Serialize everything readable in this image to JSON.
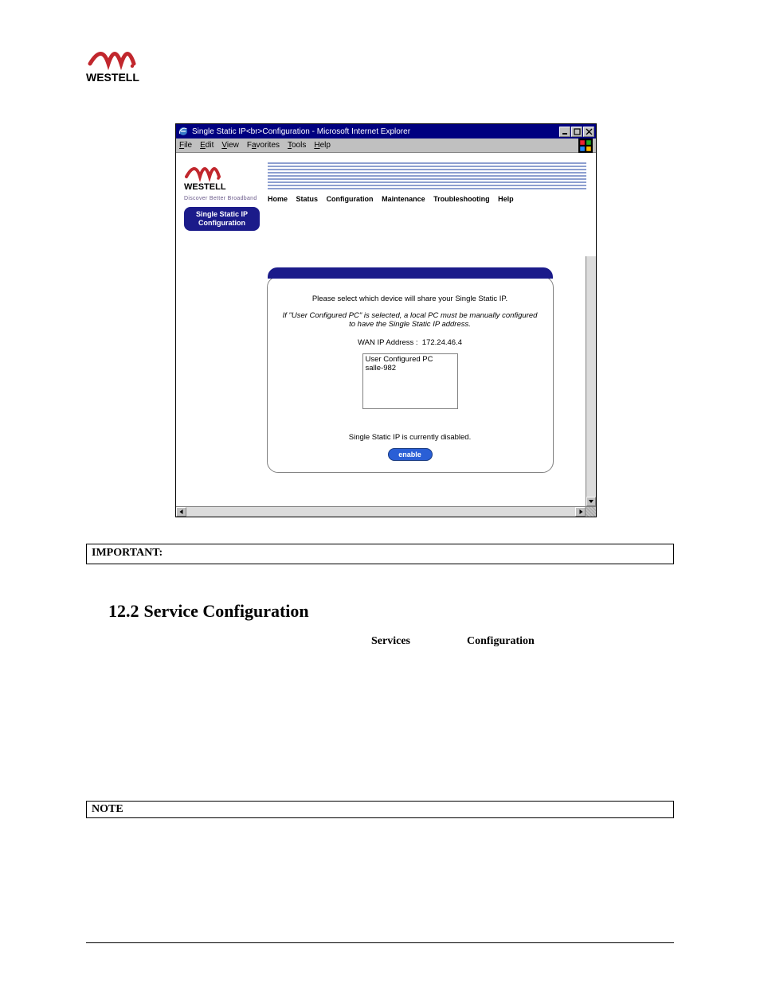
{
  "logo_text": "WESTELL",
  "screenshot": {
    "title": "Single Static IP<br>Configuration - Microsoft Internet Explorer",
    "menu": [
      "File",
      "Edit",
      "View",
      "Favorites",
      "Tools",
      "Help"
    ],
    "router": {
      "brand": "WESTELL",
      "tagline": "Discover Better Broadband",
      "nav": [
        "Home",
        "Status",
        "Configuration",
        "Maintenance",
        "Troubleshooting",
        "Help"
      ],
      "sidepill": "Single Static IP Configuration",
      "panel": {
        "line1": "Please select which device will share your Single Static IP.",
        "line2": "If \"User Configured PC\" is selected, a local PC must be manually configured to have the Single Static IP address.",
        "wan_label": "WAN IP Address :",
        "wan_value": "172.24.46.4",
        "options": [
          "User Configured PC",
          "salle-982"
        ],
        "status": "Single Static IP is currently disabled.",
        "button": "enable"
      }
    }
  },
  "important_label": "IMPORTANT:",
  "section": {
    "number": "12.2",
    "title": "Service Configuration"
  },
  "words": {
    "services": "Services",
    "configuration": "Configuration"
  },
  "note_label": "NOTE"
}
